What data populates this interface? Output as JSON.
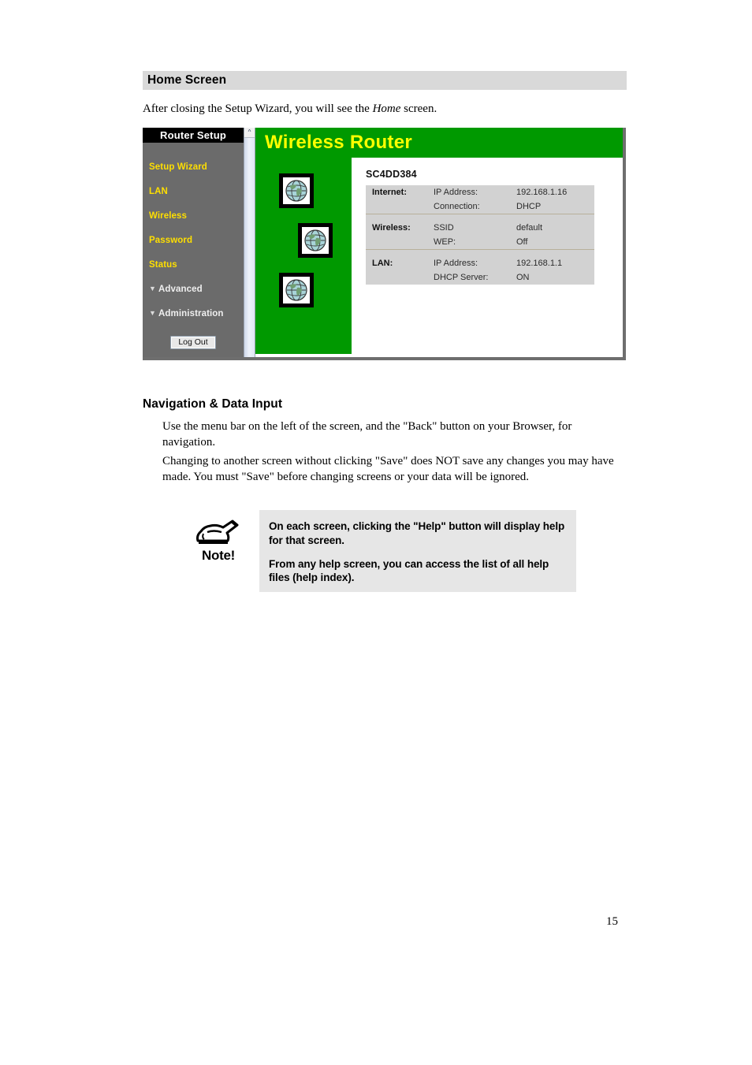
{
  "document": {
    "page_number": "15",
    "section_title": "Home Screen",
    "intro_prefix": "After closing the Setup Wizard, you will see the ",
    "intro_italic": "Home",
    "intro_suffix": " screen."
  },
  "router_screenshot": {
    "sidebar": {
      "header": "Router Setup",
      "items": [
        {
          "label": "Setup Wizard",
          "type": "link"
        },
        {
          "label": "LAN",
          "type": "link"
        },
        {
          "label": "Wireless",
          "type": "link"
        },
        {
          "label": "Password",
          "type": "link"
        },
        {
          "label": "Status",
          "type": "link"
        },
        {
          "label": "Advanced",
          "type": "group",
          "marker": "▼"
        },
        {
          "label": "Administration",
          "type": "group",
          "marker": "▼"
        }
      ],
      "logout_label": "Log Out",
      "scrollbar_up_glyph": "^"
    },
    "banner_title": "Wireless Router",
    "banner_color": "#009900",
    "banner_text_color": "#ffff00",
    "globe_icons": [
      "globe-icon",
      "globe-icon",
      "globe-icon"
    ],
    "panel": {
      "device_name": "SC4DD384",
      "groups": [
        {
          "label": "Internet:",
          "rows": [
            {
              "key": "IP Address:",
              "value": "192.168.1.16"
            },
            {
              "key": "Connection:",
              "value": "DHCP"
            }
          ]
        },
        {
          "label": "Wireless:",
          "rows": [
            {
              "key": "SSID",
              "value": "default"
            },
            {
              "key": "WEP:",
              "value": "Off"
            }
          ]
        },
        {
          "label": "LAN:",
          "rows": [
            {
              "key": "IP Address:",
              "value": "192.168.1.1"
            },
            {
              "key": "DHCP Server:",
              "value": "ON"
            }
          ]
        }
      ]
    }
  },
  "navigation_section": {
    "heading": "Navigation & Data Input",
    "paragraph_1": "Use the menu bar on the left of the screen, and the \"Back\" button on your Browser, for navigation.",
    "paragraph_2": "Changing to another screen without clicking \"Save\" does NOT save any changes you may have made. You must \"Save\" before changing screens or your data will be ignored."
  },
  "note": {
    "icon_word": "Note!",
    "line_1": "On each screen, clicking the \"Help\" button will display help for that screen.",
    "line_2": "From any help screen, you can access the list of all help files (help index)."
  }
}
